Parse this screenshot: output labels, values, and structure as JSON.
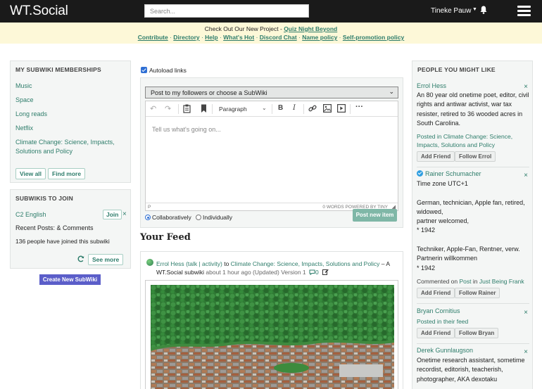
{
  "header": {
    "logo": "WT.Social",
    "search_placeholder": "Search...",
    "user_name": "Tineke Pauw"
  },
  "banner": {
    "line1_prefix": "Check Out Our New Project - ",
    "line1_link": "Quiz Night Beyond",
    "links": [
      "Contribute",
      "Directory",
      "Help",
      "What's Hot",
      "Discord Chat",
      "Name policy",
      "Self-promotion policy"
    ],
    "separator": " · "
  },
  "memberships": {
    "title": "MY SUBWIKI MEMBERSHIPS",
    "items": [
      "Music",
      "Space",
      "Long reads",
      "Netflix",
      "Climate Change: Science, Impacts, Solutions and Policy"
    ],
    "view_all": "View all",
    "find_more": "Find more"
  },
  "subwikis_to_join": {
    "title": "SUBWIKIS TO JOIN",
    "name": "C2 English",
    "join": "Join",
    "recent_posts": "Recent Posts: & Comments",
    "joined_count": "136 people have joined this subwiki",
    "see_more": "See more"
  },
  "create_subwiki": "Create New SubWiki",
  "composer": {
    "autoload_label": "Autoload links",
    "autoload_checked": true,
    "target_select": "Post to my followers or choose a SubWiki",
    "paragraph": "Paragraph",
    "placeholder": "Tell us what's going on...",
    "status_path": "P",
    "status_right": "0 WORDS  POWERED BY TINY",
    "option_collab": "Collaboratively",
    "option_individual": "Individually",
    "selected_option": "Collaboratively",
    "post_button": "Post new item"
  },
  "feed": {
    "title": "Your Feed",
    "post": {
      "author": "Errol Hess",
      "talk": "(talk | activity)",
      "to": " to ",
      "subwiki": "Climate Change: Science, Impacts, Solutions and Policy",
      "dash": " – A",
      "subtitle": "WT.Social subwiki",
      "time": "about 1 hour ago (Updated) Version 1",
      "comment_count": "0"
    }
  },
  "people": {
    "title": "PEOPLE YOU MIGHT LIKE",
    "close": "×",
    "add_friend": "Add Friend",
    "list": [
      {
        "name": "Errol Hess",
        "bio": "An 80 year old onetime poet, editor, civil rights and antiwar activist, war tax resister, retired to 36 wooded acres in South Carolina.",
        "posted_prefix": "Posted in ",
        "posted_in": "Climate Change: Science, Impacts, Solutions and Policy",
        "follow": "Follow Errol"
      },
      {
        "name": "Rainer Schumacher",
        "verified": true,
        "bio_lines": [
          "Time zone UTC+1",
          "",
          "German, technician, Apple fan, retired, widowed,",
          "partner welcomed,",
          "* 1942",
          "",
          "Techniker, Apple-Fan, Rentner, verw. Partnerin willkommen",
          "* 1942"
        ],
        "commented_prefix": "Commented on ",
        "commented_on": "Post",
        "commented_mid": " in ",
        "commented_in": "Just Being Frank",
        "follow": "Follow Rainer"
      },
      {
        "name": "Bryan Cornitius",
        "posted_prefix": "Posted in ",
        "posted_in": "their feed",
        "follow": "Follow Bryan"
      },
      {
        "name": "Derek Gunnlaugson",
        "bio": "Onetime research assistant, sometime recordist, editorish, teacherish, photographer, AKA dexotaku"
      }
    ]
  }
}
